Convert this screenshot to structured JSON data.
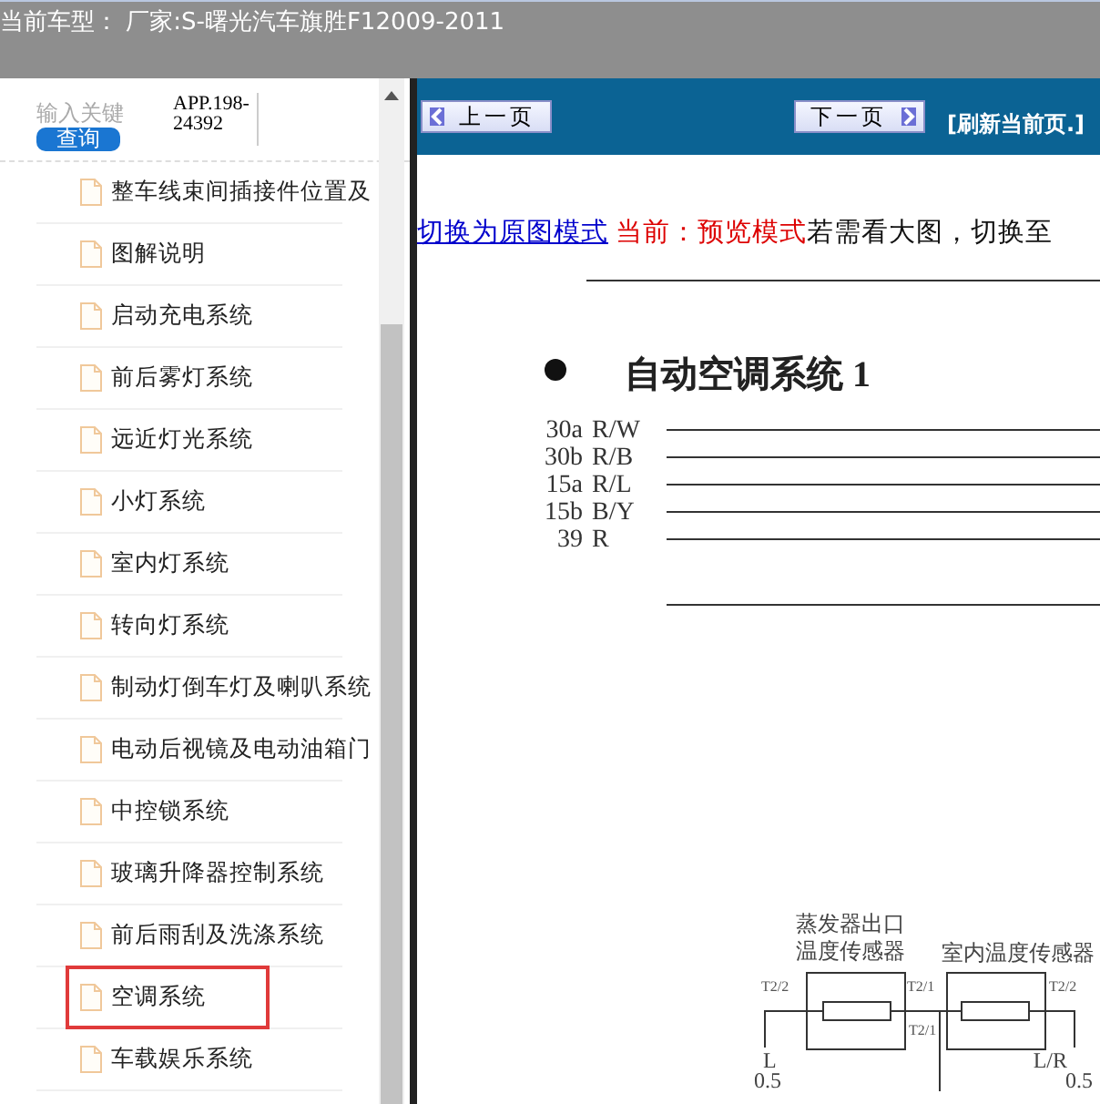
{
  "window": {
    "title": "当前车型： 厂家:S-曙光汽车旗胜F12009-2011"
  },
  "search": {
    "label": "输入关键",
    "button": "查询",
    "value": "APP.198-24392"
  },
  "sidebar": {
    "items": [
      {
        "label": "整车线束间插接件位置及",
        "selected": false
      },
      {
        "label": "图解说明",
        "selected": false
      },
      {
        "label": "启动充电系统",
        "selected": false
      },
      {
        "label": "前后雾灯系统",
        "selected": false
      },
      {
        "label": "远近灯光系统",
        "selected": false
      },
      {
        "label": "小灯系统",
        "selected": false
      },
      {
        "label": "室内灯系统",
        "selected": false
      },
      {
        "label": "转向灯系统",
        "selected": false
      },
      {
        "label": "制动灯倒车灯及喇叭系统",
        "selected": false
      },
      {
        "label": "电动后视镜及电动油箱门",
        "selected": false
      },
      {
        "label": "中控锁系统",
        "selected": false
      },
      {
        "label": "玻璃升降器控制系统",
        "selected": false
      },
      {
        "label": "前后雨刮及洗涤系统",
        "selected": false
      },
      {
        "label": "空调系统",
        "selected": true
      },
      {
        "label": "车载娱乐系统",
        "selected": false
      }
    ]
  },
  "toolbar": {
    "prev": "上一页",
    "next": "下一页",
    "refresh": "[刷新当前页.]"
  },
  "document": {
    "switch_link": "切换为原图模式",
    "mode": "当前：预览模式",
    "hint": "若需看大图，切换至",
    "title": "自动空调系统 1",
    "wires": [
      {
        "pin": "30a",
        "code": "R/W"
      },
      {
        "pin": "30b",
        "code": "R/B"
      },
      {
        "pin": "15a",
        "code": "R/L"
      },
      {
        "pin": "15b",
        "code": "B/Y"
      },
      {
        "pin": "39",
        "code": "R"
      }
    ],
    "sensors": [
      {
        "name_lines": [
          "蒸发器出口",
          "温度传感器"
        ],
        "pin_left": "T2/2",
        "pin_right": "T2/1",
        "wire": "L",
        "gauge": "0.5"
      },
      {
        "name_lines": [
          "室内温度传感器"
        ],
        "pin_left": "T2/1",
        "pin_right": "T2/2",
        "wire": "L/R",
        "gauge": "0.5"
      }
    ]
  }
}
